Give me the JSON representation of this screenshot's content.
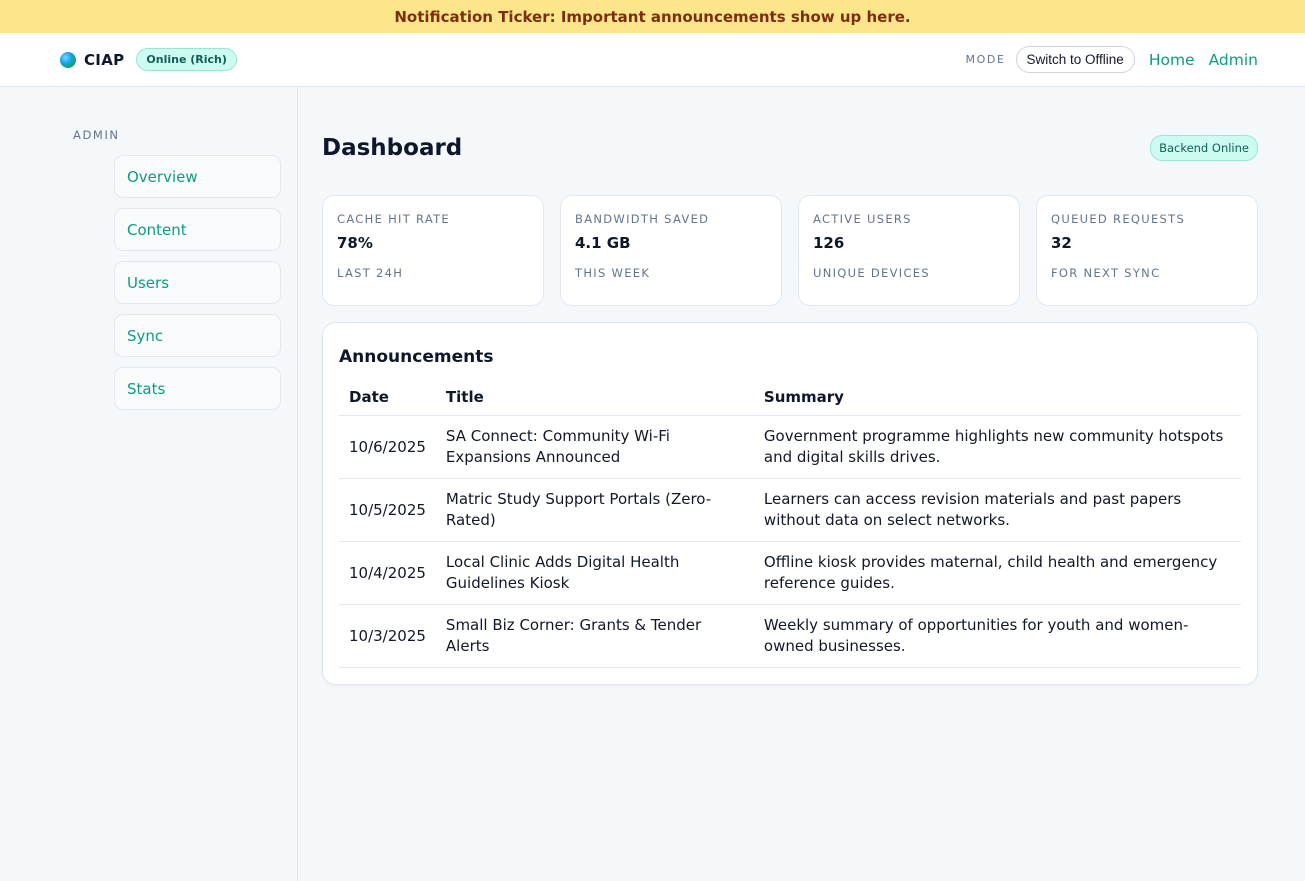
{
  "ticker": {
    "text": "Notification Ticker: Important announcements show up here."
  },
  "header": {
    "brand": "CIAP",
    "status": "Online (Rich)",
    "mode_label": "MODE",
    "mode_button": "Switch to Offline",
    "links": [
      "Home",
      "Admin"
    ]
  },
  "sidebar": {
    "heading": "ADMIN",
    "items": [
      {
        "label": "Overview"
      },
      {
        "label": "Content"
      },
      {
        "label": "Users"
      },
      {
        "label": "Sync"
      },
      {
        "label": "Stats"
      }
    ]
  },
  "main": {
    "title": "Dashboard",
    "backend_status": "Backend Online",
    "stats": [
      {
        "label": "CACHE HIT RATE",
        "value": "78%",
        "sub": "LAST 24H"
      },
      {
        "label": "BANDWIDTH SAVED",
        "value": "4.1 GB",
        "sub": "THIS WEEK"
      },
      {
        "label": "ACTIVE USERS",
        "value": "126",
        "sub": "UNIQUE DEVICES"
      },
      {
        "label": "QUEUED REQUESTS",
        "value": "32",
        "sub": "FOR NEXT SYNC"
      }
    ],
    "announcements": {
      "title": "Announcements",
      "columns": [
        "Date",
        "Title",
        "Summary"
      ],
      "rows": [
        {
          "date": "10/6/2025",
          "title": "SA Connect: Community Wi-Fi Expansions Announced",
          "summary": "Government programme highlights new community hotspots and digital skills drives."
        },
        {
          "date": "10/5/2025",
          "title": "Matric Study Support Portals (Zero-Rated)",
          "summary": "Learners can access revision materials and past papers without data on select networks."
        },
        {
          "date": "10/4/2025",
          "title": "Local Clinic Adds Digital Health Guidelines Kiosk",
          "summary": "Offline kiosk provides maternal, child health and emergency reference guides."
        },
        {
          "date": "10/3/2025",
          "title": "Small Biz Corner: Grants & Tender Alerts",
          "summary": "Weekly summary of opportunities for youth and women-owned businesses."
        }
      ]
    }
  }
}
